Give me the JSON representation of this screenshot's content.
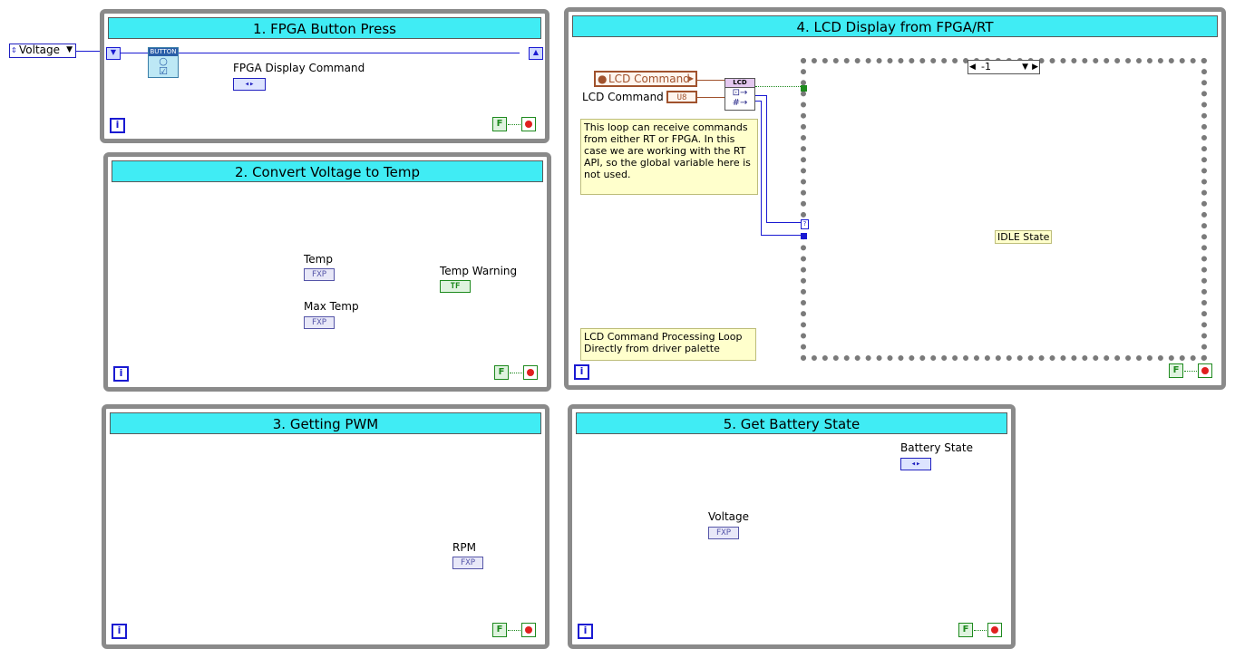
{
  "external_control": {
    "label": "Voltage"
  },
  "loops": {
    "fpga_button": {
      "title": "1. FPGA Button Press",
      "button_node": "BUTTON",
      "indicator_label": "FPGA Display Command",
      "iteration_label": "i",
      "stop_label": "F"
    },
    "convert": {
      "title": "2. Convert Voltage to Temp",
      "temp_label": "Temp",
      "temp_term": "FXP",
      "max_temp_label": "Max Temp",
      "max_temp_term": "FXP",
      "warning_label": "Temp Warning",
      "warning_term": "TF",
      "iteration_label": "i",
      "stop_label": "F"
    },
    "pwm": {
      "title": "3. Getting PWM",
      "rpm_label": "RPM",
      "rpm_term": "FXP",
      "iteration_label": "i",
      "stop_label": "F"
    },
    "lcd": {
      "title": "4. LCD Display from FPGA/RT",
      "global_var": "LCD Command",
      "control_label": "LCD Command",
      "control_term": "U8",
      "lcd_node": "LCD",
      "comment_1": "This loop can receive commands from either RT or FPGA. In this case we are working with the RT API, so the global variable here is not used.",
      "comment_2": "LCD Command Processing Loop Directly from driver palette",
      "case_selector": "-1",
      "case_content": "IDLE State",
      "iteration_label": "i",
      "stop_label": "F"
    },
    "battery": {
      "title": "5. Get Battery State",
      "battery_label": "Battery State",
      "voltage_label": "Voltage",
      "voltage_term": "FXP",
      "iteration_label": "i",
      "stop_label": "F"
    }
  }
}
